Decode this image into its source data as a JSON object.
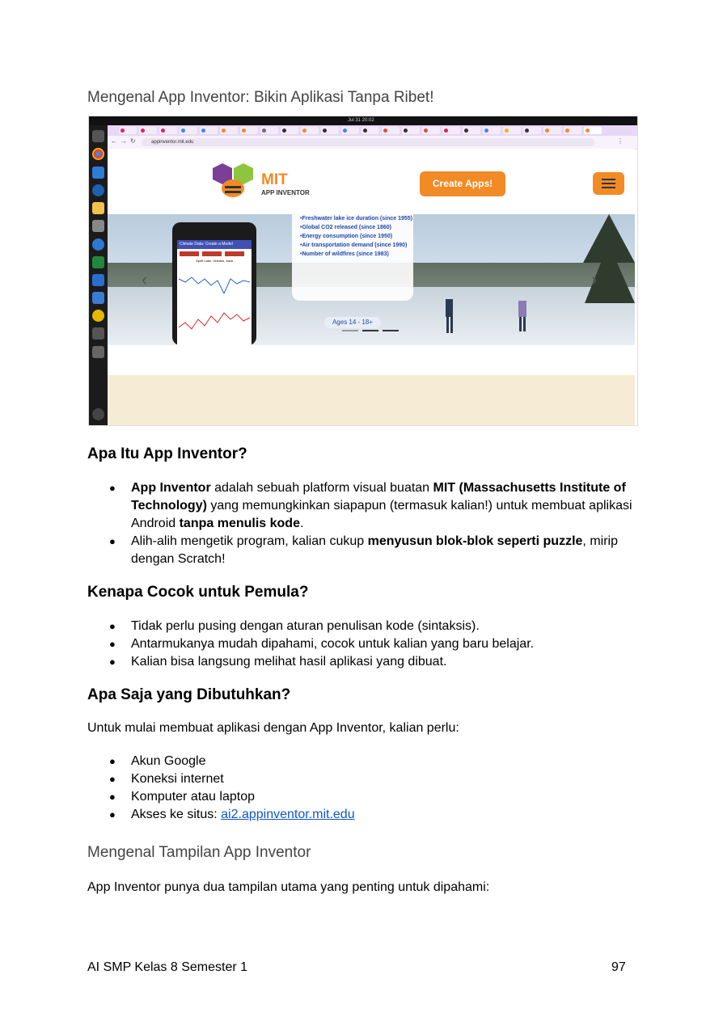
{
  "heading_intro": "Mengenal App Inventor: Bikin Aplikasi Tanpa Ribet!",
  "screenshot": {
    "clock": "Jul 31  20:02",
    "url": "appinventor.mit.edu",
    "logo_title": "MIT",
    "logo_subtitle": "APP INVENTOR",
    "create_button": "Create Apps!",
    "phone_app_title": "Climate Data: Create a Model",
    "phone_chart_title": "Spirit Lake, Orleans, Iowa",
    "data_items": [
      "Freshwater lake ice duration (since 1955)",
      "Global CO2 released (since 1860)",
      "Energy consumption (since 1950)",
      "Air transportation demand (since 1990)",
      "Number of wildfires (since 1983)"
    ],
    "ages_badge": "Ages 14 - 18+",
    "prev_icon": "chevron-left-icon",
    "next_icon": "chevron-right-icon"
  },
  "section_what": {
    "title": "Apa Itu App Inventor?",
    "b1_bold1": "App Inventor",
    "b1_text1": " adalah sebuah platform visual buatan ",
    "b1_bold2": "MIT (Massachusetts Institute of Technology)",
    "b1_text2": " yang memungkinkan siapapun (termasuk kalian!) untuk membuat aplikasi Android ",
    "b1_bold3": "tanpa menulis kode",
    "b1_text3": ".",
    "b2_text1": "Alih-alih mengetik program, kalian cukup ",
    "b2_bold1": "menyusun blok-blok seperti puzzle",
    "b2_text2": ", mirip dengan Scratch!"
  },
  "section_why": {
    "title": "Kenapa Cocok untuk Pemula?",
    "items": [
      "Tidak perlu pusing dengan aturan penulisan kode (sintaksis).",
      "Antarmukanya mudah dipahami, cocok untuk kalian yang baru belajar.",
      "Kalian bisa langsung melihat hasil aplikasi yang dibuat."
    ]
  },
  "section_needs": {
    "title": "Apa Saja yang Dibutuhkan?",
    "intro": "Untuk mulai membuat aplikasi dengan App Inventor, kalian perlu:",
    "items": [
      "Akun Google",
      "Koneksi internet",
      "Komputer atau laptop"
    ],
    "last_prefix": "Akses ke situs: ",
    "last_link": "ai2.appinventor.mit.edu"
  },
  "heading_view": "Mengenal Tampilan App Inventor",
  "view_intro": "App Inventor punya dua tampilan utama yang penting untuk dipahami:",
  "footer": {
    "left": "AI SMP Kelas 8 Semester 1",
    "page": "97"
  },
  "colors": {
    "accent_orange": "#f28b26",
    "link": "#1155cc",
    "hero_text": "#2348a8"
  }
}
